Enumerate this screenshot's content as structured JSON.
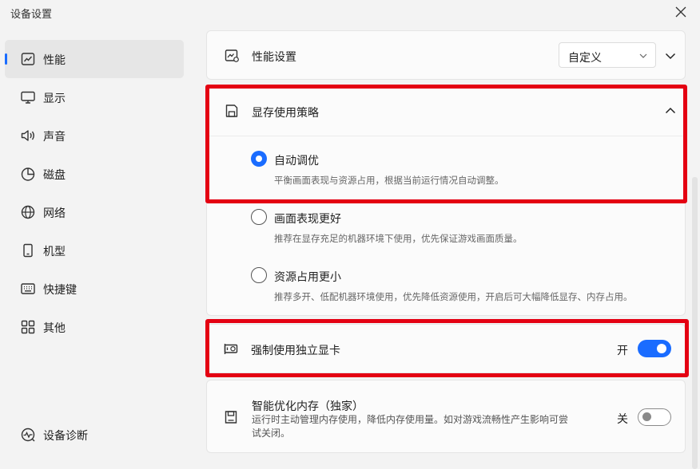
{
  "window": {
    "title": "设备设置"
  },
  "sidebar": {
    "items": [
      {
        "label": "性能",
        "icon": "chart-line-icon"
      },
      {
        "label": "显示",
        "icon": "monitor-icon"
      },
      {
        "label": "声音",
        "icon": "speaker-icon"
      },
      {
        "label": "磁盘",
        "icon": "pie-chart-icon"
      },
      {
        "label": "网络",
        "icon": "globe-icon"
      },
      {
        "label": "机型",
        "icon": "phone-icon"
      },
      {
        "label": "快捷键",
        "icon": "keyboard-icon"
      },
      {
        "label": "其他",
        "icon": "grid-icon"
      }
    ],
    "active_index": 0,
    "footer": {
      "label": "设备诊断",
      "icon": "diagnostics-icon"
    }
  },
  "performance": {
    "title": "性能设置",
    "dropdown_value": "自定义"
  },
  "memory_strategy": {
    "title": "显存使用策略",
    "options": [
      {
        "title": "自动调优",
        "desc": "平衡画面表现与资源占用，根据当前运行情况自动调整。",
        "checked": true
      },
      {
        "title": "画面表现更好",
        "desc": "推荐在显存充足的机器环境下使用，优先保证游戏画面质量。",
        "checked": false
      },
      {
        "title": "资源占用更小",
        "desc": "推荐多开、低配机器环境使用，优先降低资源使用，开启后可大幅降低显存、内存占用。",
        "checked": false
      }
    ]
  },
  "dedicated_gpu": {
    "title": "强制使用独立显卡",
    "state_label": "开",
    "enabled": true
  },
  "smart_memory": {
    "title": "智能优化内存（独家）",
    "desc": "运行时主动管理内存使用，降低内存使用量。如对游戏流畅性产生影响可尝试关闭。",
    "state_label": "关",
    "enabled": false
  },
  "colors": {
    "accent": "#1a6cff",
    "highlight": "#e40012"
  }
}
